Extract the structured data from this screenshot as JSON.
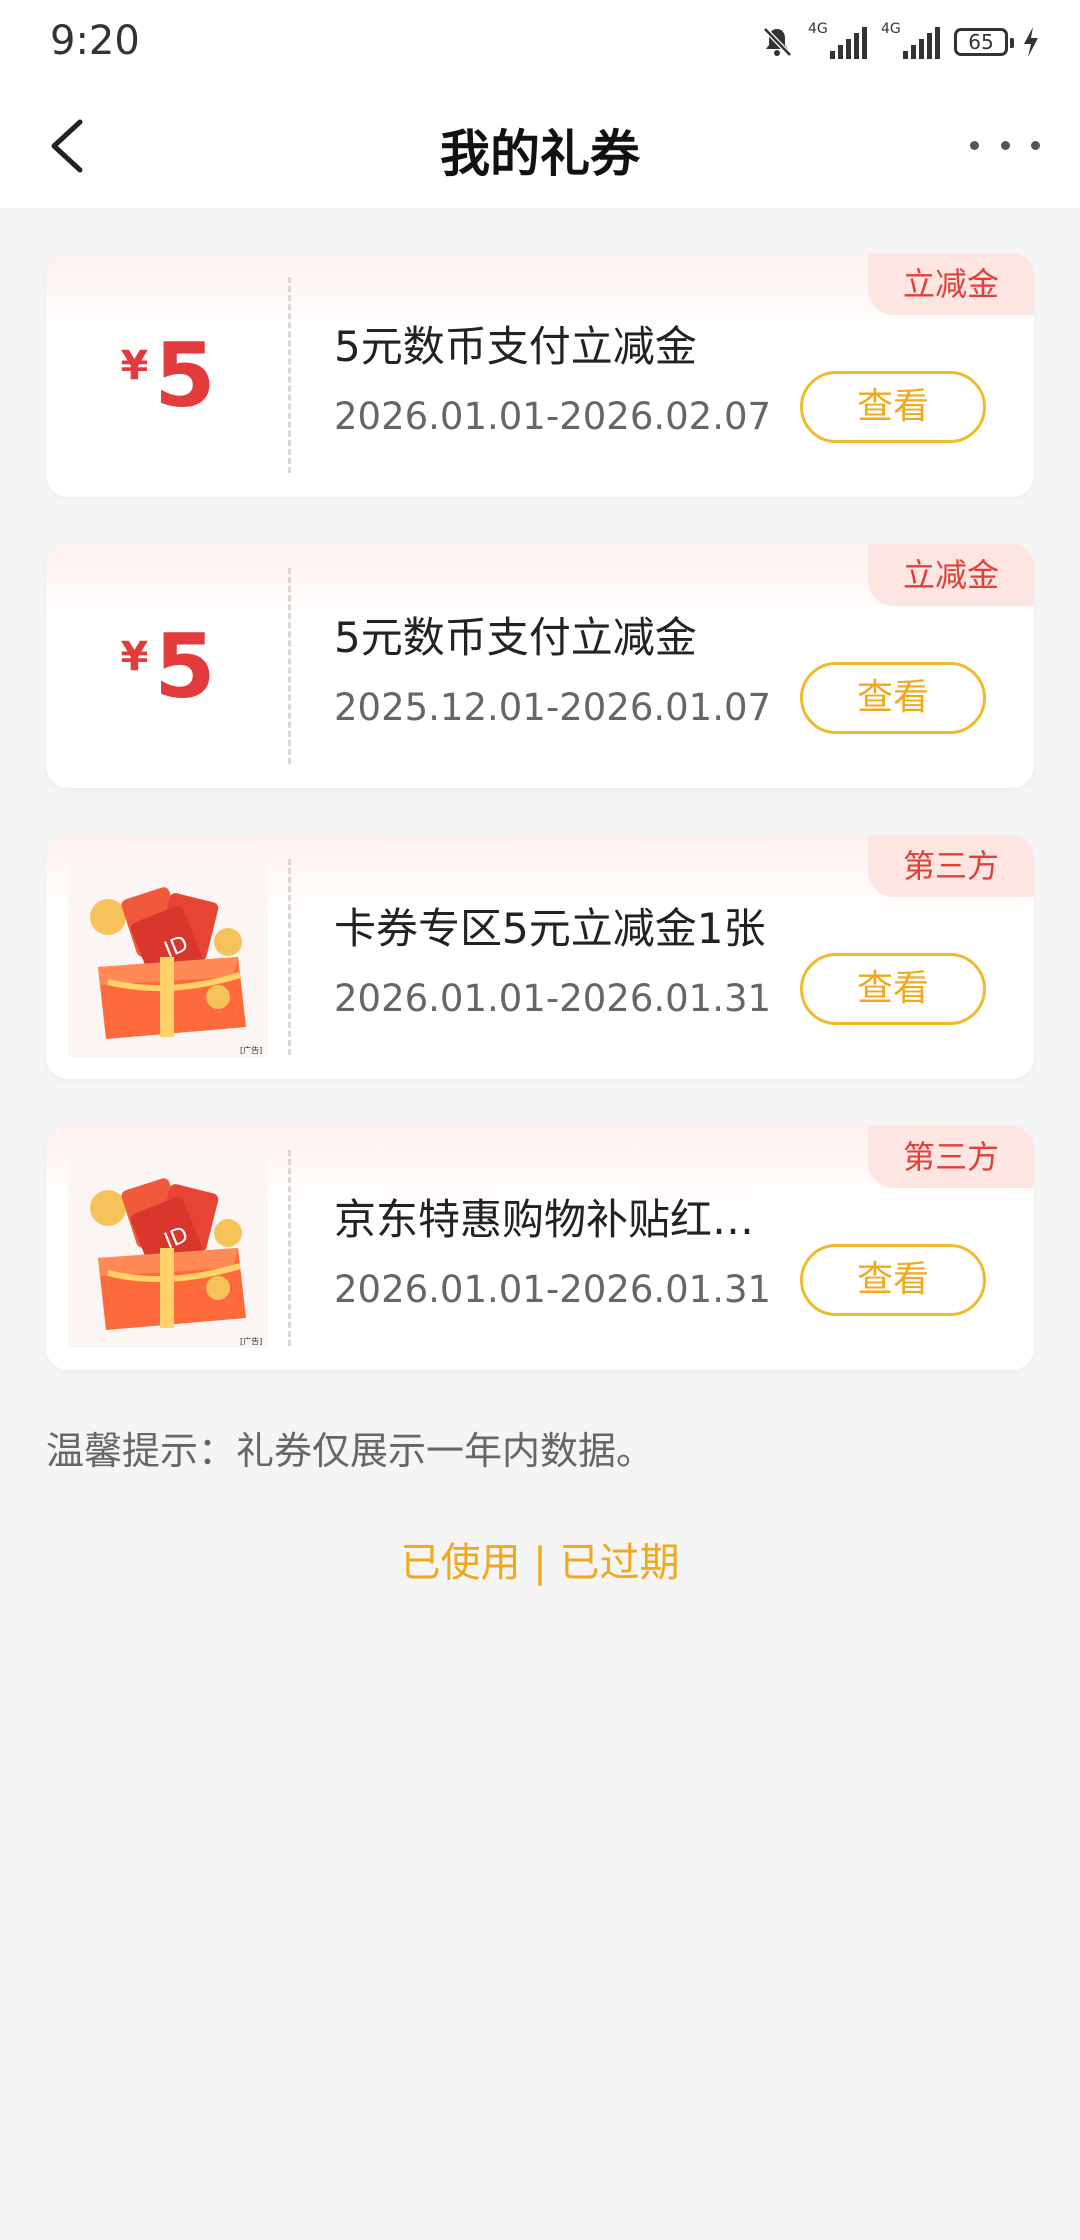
{
  "status_bar": {
    "time": "9:20",
    "battery": "65",
    "net1": "4G",
    "net2": "4G"
  },
  "header": {
    "title": "我的礼券",
    "back_icon": "chevron-left-icon",
    "more_icon": "more-dots-icon"
  },
  "coupons": [
    {
      "tag": "立减金",
      "type": "amount",
      "currency": "¥",
      "amount": "5",
      "name": "5元数币支付立减金",
      "date": "2026.01.01-2026.02.07",
      "button": "查看"
    },
    {
      "tag": "立减金",
      "type": "amount",
      "currency": "¥",
      "amount": "5",
      "name": "5元数币支付立减金",
      "date": "2025.12.01-2026.01.07",
      "button": "查看"
    },
    {
      "tag": "第三方",
      "type": "image",
      "image_icon": "gift-box-icon",
      "name": "卡券专区5元立减金1张",
      "date": "2026.01.01-2026.01.31",
      "button": "查看"
    },
    {
      "tag": "第三方",
      "type": "image",
      "image_icon": "gift-box-icon",
      "name": "京东特惠购物补贴红…",
      "date": "2026.01.01-2026.01.31",
      "button": "查看"
    }
  ],
  "footer": {
    "tip": "温馨提示：礼券仅展示一年内数据。",
    "used": "已使用",
    "separator": " | ",
    "expired": "已过期"
  },
  "colors": {
    "accent": "#f0a81c",
    "amount_red": "#e33b3b",
    "tag_bg": "#fde5e1"
  }
}
